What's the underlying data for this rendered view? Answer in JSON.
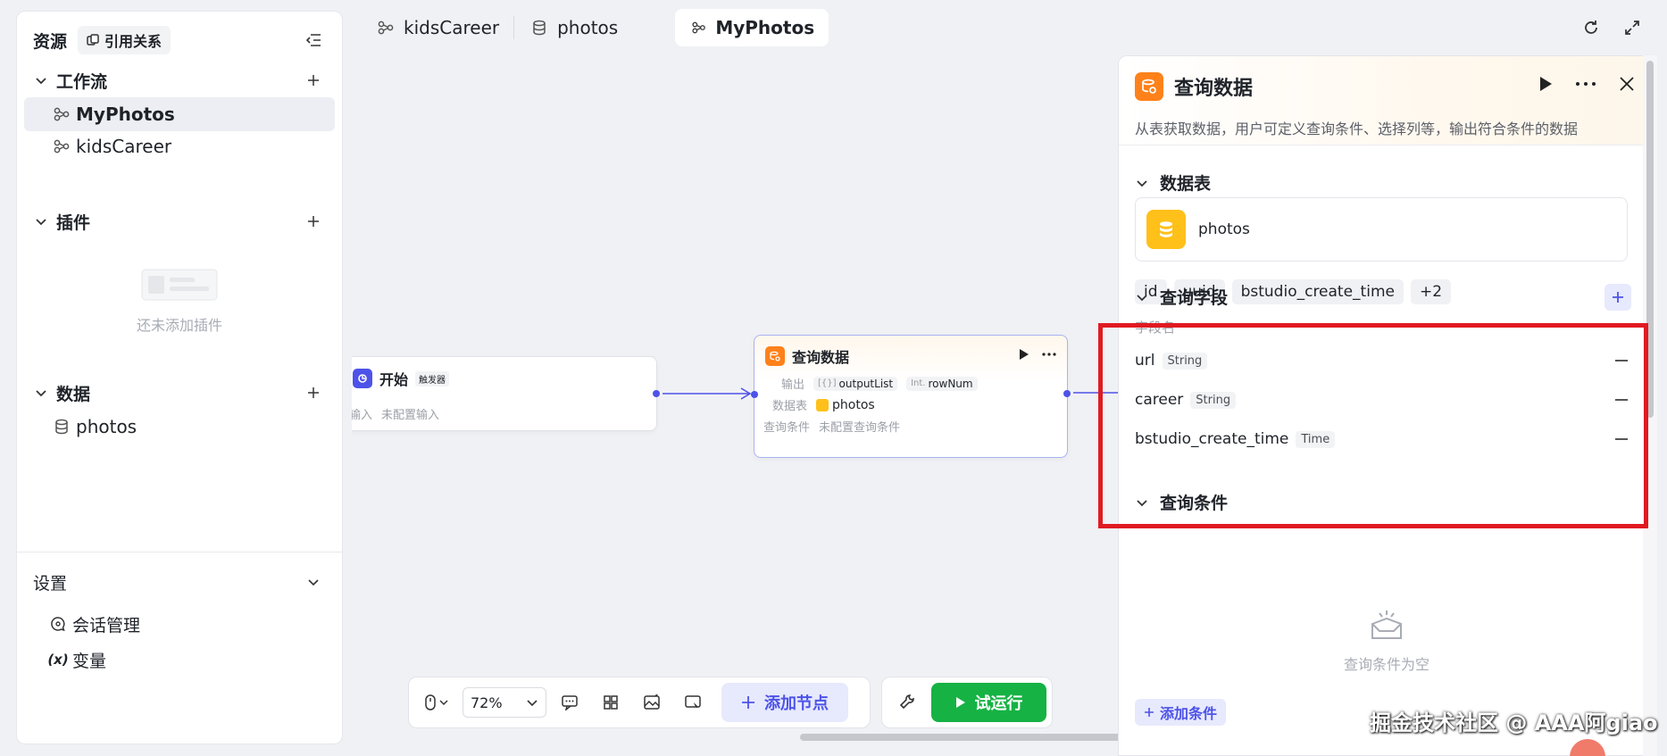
{
  "sidebar": {
    "title": "资源",
    "ref_button": "引用关系",
    "sections": {
      "workflow": {
        "label": "工作流",
        "items": [
          "MyPhotos",
          "kidsCareer"
        ]
      },
      "plugins": {
        "label": "插件",
        "empty_text": "还未添加插件"
      },
      "data": {
        "label": "数据",
        "items": [
          "photos"
        ]
      }
    },
    "settings": {
      "label": "设置",
      "items": [
        {
          "icon": "chat-settings-icon",
          "label": "会话管理"
        },
        {
          "icon": "variable-icon",
          "label": "变量",
          "glyph": "(x)"
        }
      ]
    }
  },
  "tabs": [
    {
      "label": "kidsCareer",
      "icon": "workflow-icon"
    },
    {
      "label": "photos",
      "icon": "database-icon"
    },
    {
      "label": "MyPhotos",
      "icon": "workflow-icon",
      "active": true
    }
  ],
  "canvas": {
    "start_node": {
      "title": "开始",
      "tag": "触发器",
      "row_label": "输入",
      "row_value": "未配置输入"
    },
    "query_node": {
      "title": "查询数据",
      "output_label": "输出",
      "outputs": [
        {
          "type": "[{}]",
          "name": "outputList"
        },
        {
          "type": "Int.",
          "name": "rowNum"
        }
      ],
      "table_label": "数据表",
      "table_value": "photos",
      "cond_label": "查询条件",
      "cond_value": "未配置查询条件"
    }
  },
  "toolbar": {
    "zoom": "72%",
    "add_node": "添加节点",
    "run": "试运行"
  },
  "panel": {
    "title": "查询数据",
    "description": "从表获取数据，用户可定义查询条件、选择列等，输出符合条件的数据",
    "table_section": "数据表",
    "table_name": "photos",
    "columns": [
      "id",
      "uuid",
      "bstudio_create_time",
      "+2"
    ],
    "fields_section": "查询字段",
    "field_header": "字段名",
    "fields": [
      {
        "name": "url",
        "type": "String"
      },
      {
        "name": "career",
        "type": "String"
      },
      {
        "name": "bstudio_create_time",
        "type": "Time"
      }
    ],
    "cond_section": "查询条件",
    "cond_empty": "查询条件为空",
    "add_cond": "添加条件"
  },
  "watermark": "掘金技术社区 @ AAA阿giao",
  "colors": {
    "accent": "#4d53e8",
    "run": "#16b244",
    "highlight": "#e11a22",
    "db_icon": "#ffc01a",
    "node_icon": "#ff811a"
  }
}
